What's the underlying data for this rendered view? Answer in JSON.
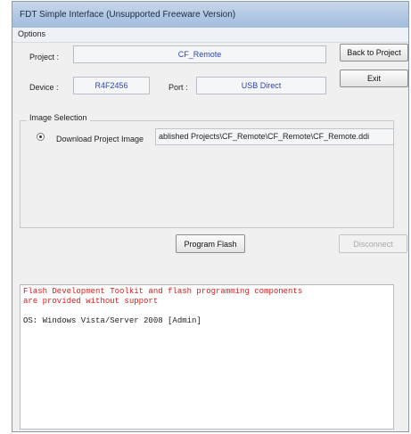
{
  "window": {
    "title": "FDT Simple Interface  (Unsupported Freeware Version)"
  },
  "menu": {
    "options_label": "Options"
  },
  "project": {
    "label": "Project :",
    "value": "CF_Remote"
  },
  "device": {
    "label": "Device :",
    "value": "R4F2456"
  },
  "port": {
    "label": "Port :",
    "value": "USB Direct"
  },
  "buttons": {
    "back_to_project": "Back to Project",
    "exit": "Exit",
    "program_flash": "Program Flash",
    "disconnect": "Disconnect"
  },
  "image_selection": {
    "group_label": "Image Selection",
    "download_label": "Download Project Image",
    "download_selected": true,
    "path": "ablished Projects\\CF_Remote\\CF_Remote\\CF_Remote.ddi"
  },
  "console": {
    "lines": [
      {
        "text": "Flash Development Toolkit and flash programming components",
        "color": "#d42020"
      },
      {
        "text": "are provided without support",
        "color": "#d42020"
      },
      {
        "text": "",
        "color": "#222222"
      },
      {
        "text": "OS: Windows Vista/Server 2008 [Admin]",
        "color": "#222222"
      }
    ]
  }
}
